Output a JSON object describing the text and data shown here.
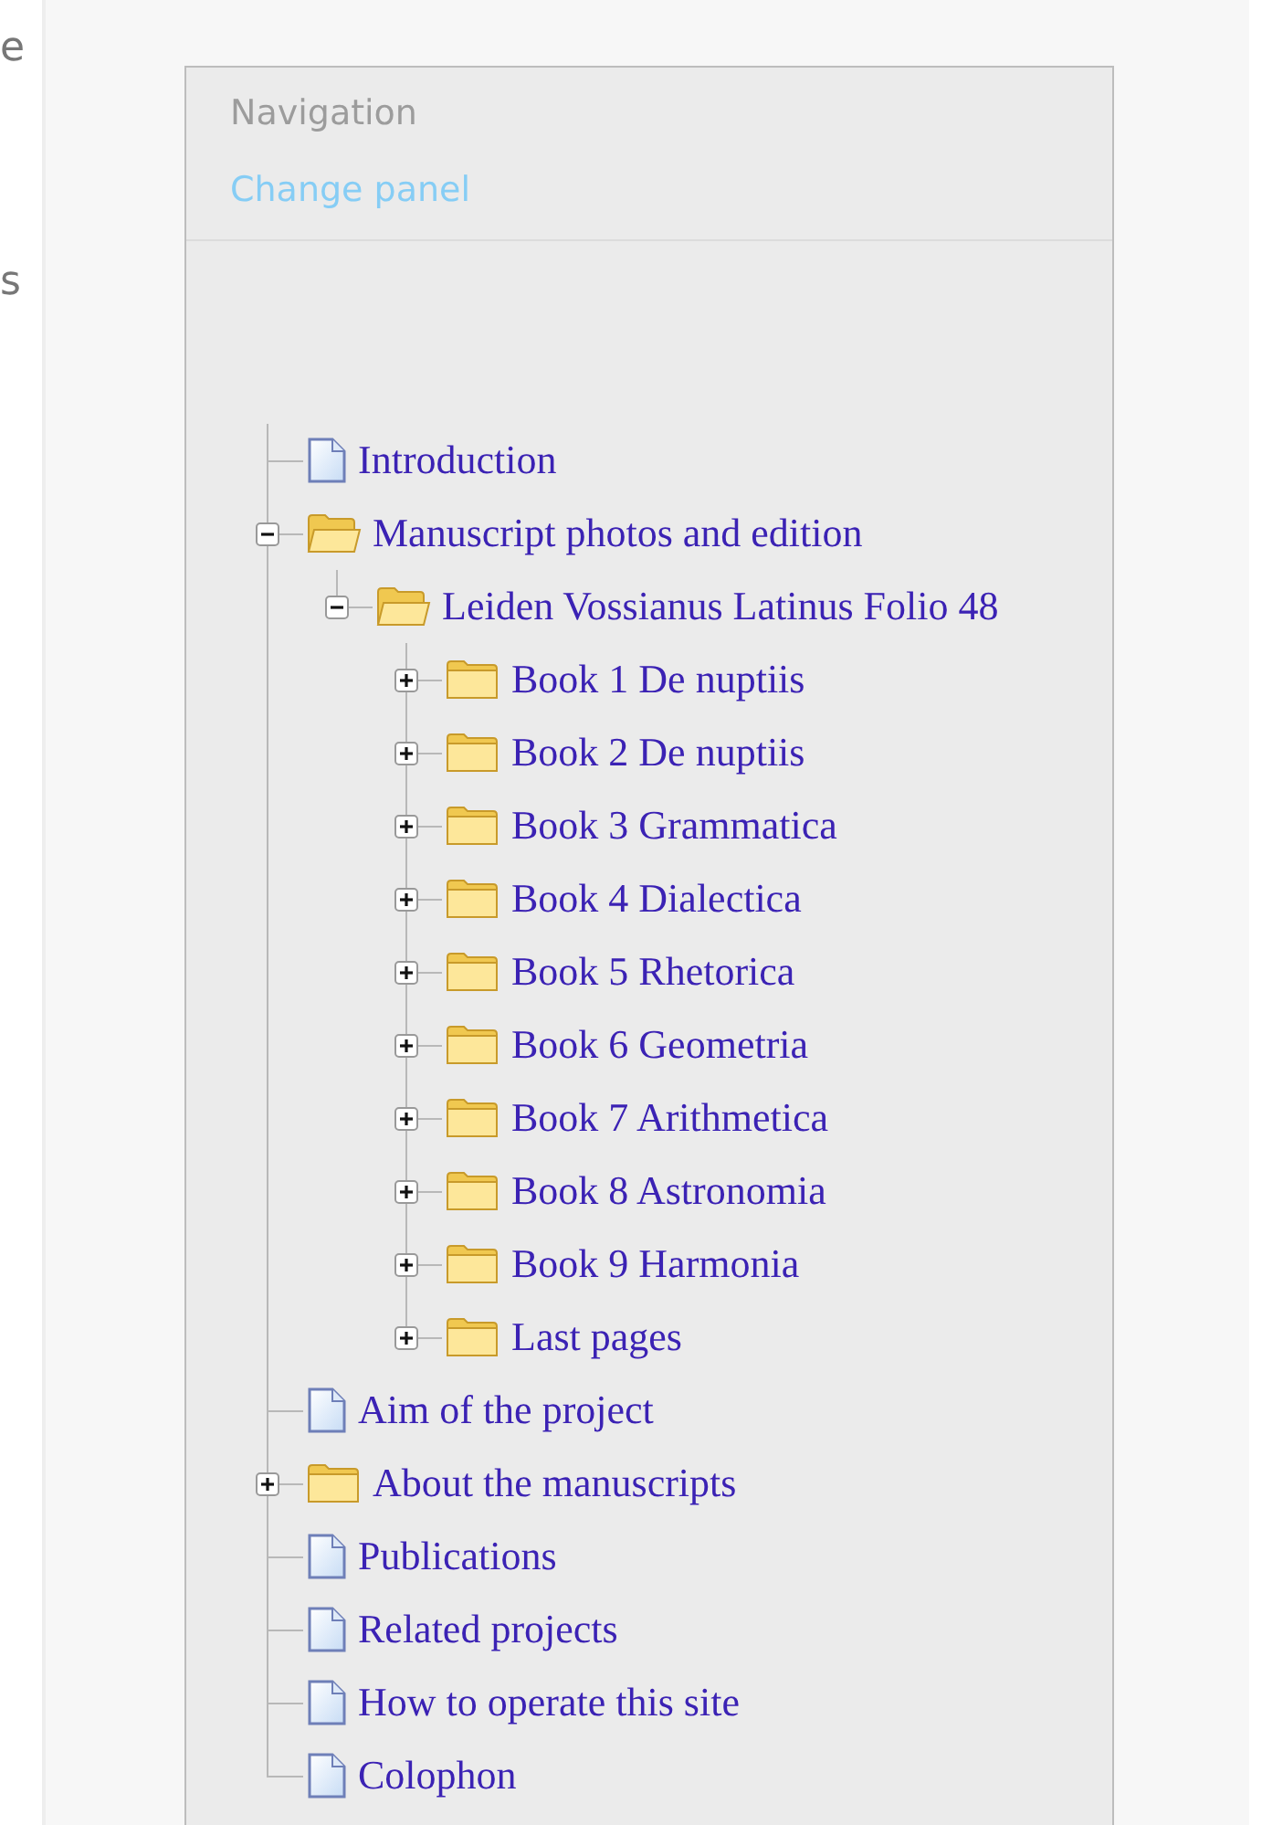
{
  "edge_letters": [
    "e",
    "s"
  ],
  "panel": {
    "title": "Navigation",
    "link": "Change panel"
  },
  "tree": [
    {
      "label": "Introduction",
      "kind": "page"
    },
    {
      "label": "Manuscript photos and edition",
      "kind": "folder",
      "expanded": true,
      "children": [
        {
          "label": "Leiden Vossianus Latinus Folio 48",
          "kind": "folder",
          "expanded": true,
          "children": [
            {
              "label": "Book 1 De nuptiis",
              "kind": "folder",
              "expanded": false
            },
            {
              "label": "Book 2 De nuptiis",
              "kind": "folder",
              "expanded": false
            },
            {
              "label": "Book 3 Grammatica",
              "kind": "folder",
              "expanded": false
            },
            {
              "label": "Book 4 Dialectica",
              "kind": "folder",
              "expanded": false
            },
            {
              "label": "Book 5 Rhetorica",
              "kind": "folder",
              "expanded": false
            },
            {
              "label": "Book 6 Geometria",
              "kind": "folder",
              "expanded": false
            },
            {
              "label": "Book 7 Arithmetica",
              "kind": "folder",
              "expanded": false
            },
            {
              "label": "Book 8 Astronomia",
              "kind": "folder",
              "expanded": false
            },
            {
              "label": "Book 9 Harmonia",
              "kind": "folder",
              "expanded": false
            },
            {
              "label": "Last pages",
              "kind": "folder",
              "expanded": false
            }
          ]
        }
      ]
    },
    {
      "label": "Aim of the project",
      "kind": "page"
    },
    {
      "label": "About the manuscripts",
      "kind": "folder",
      "expanded": false
    },
    {
      "label": "Publications",
      "kind": "page"
    },
    {
      "label": "Related projects",
      "kind": "page"
    },
    {
      "label": "How to operate this site",
      "kind": "page"
    },
    {
      "label": "Colophon",
      "kind": "page"
    }
  ]
}
